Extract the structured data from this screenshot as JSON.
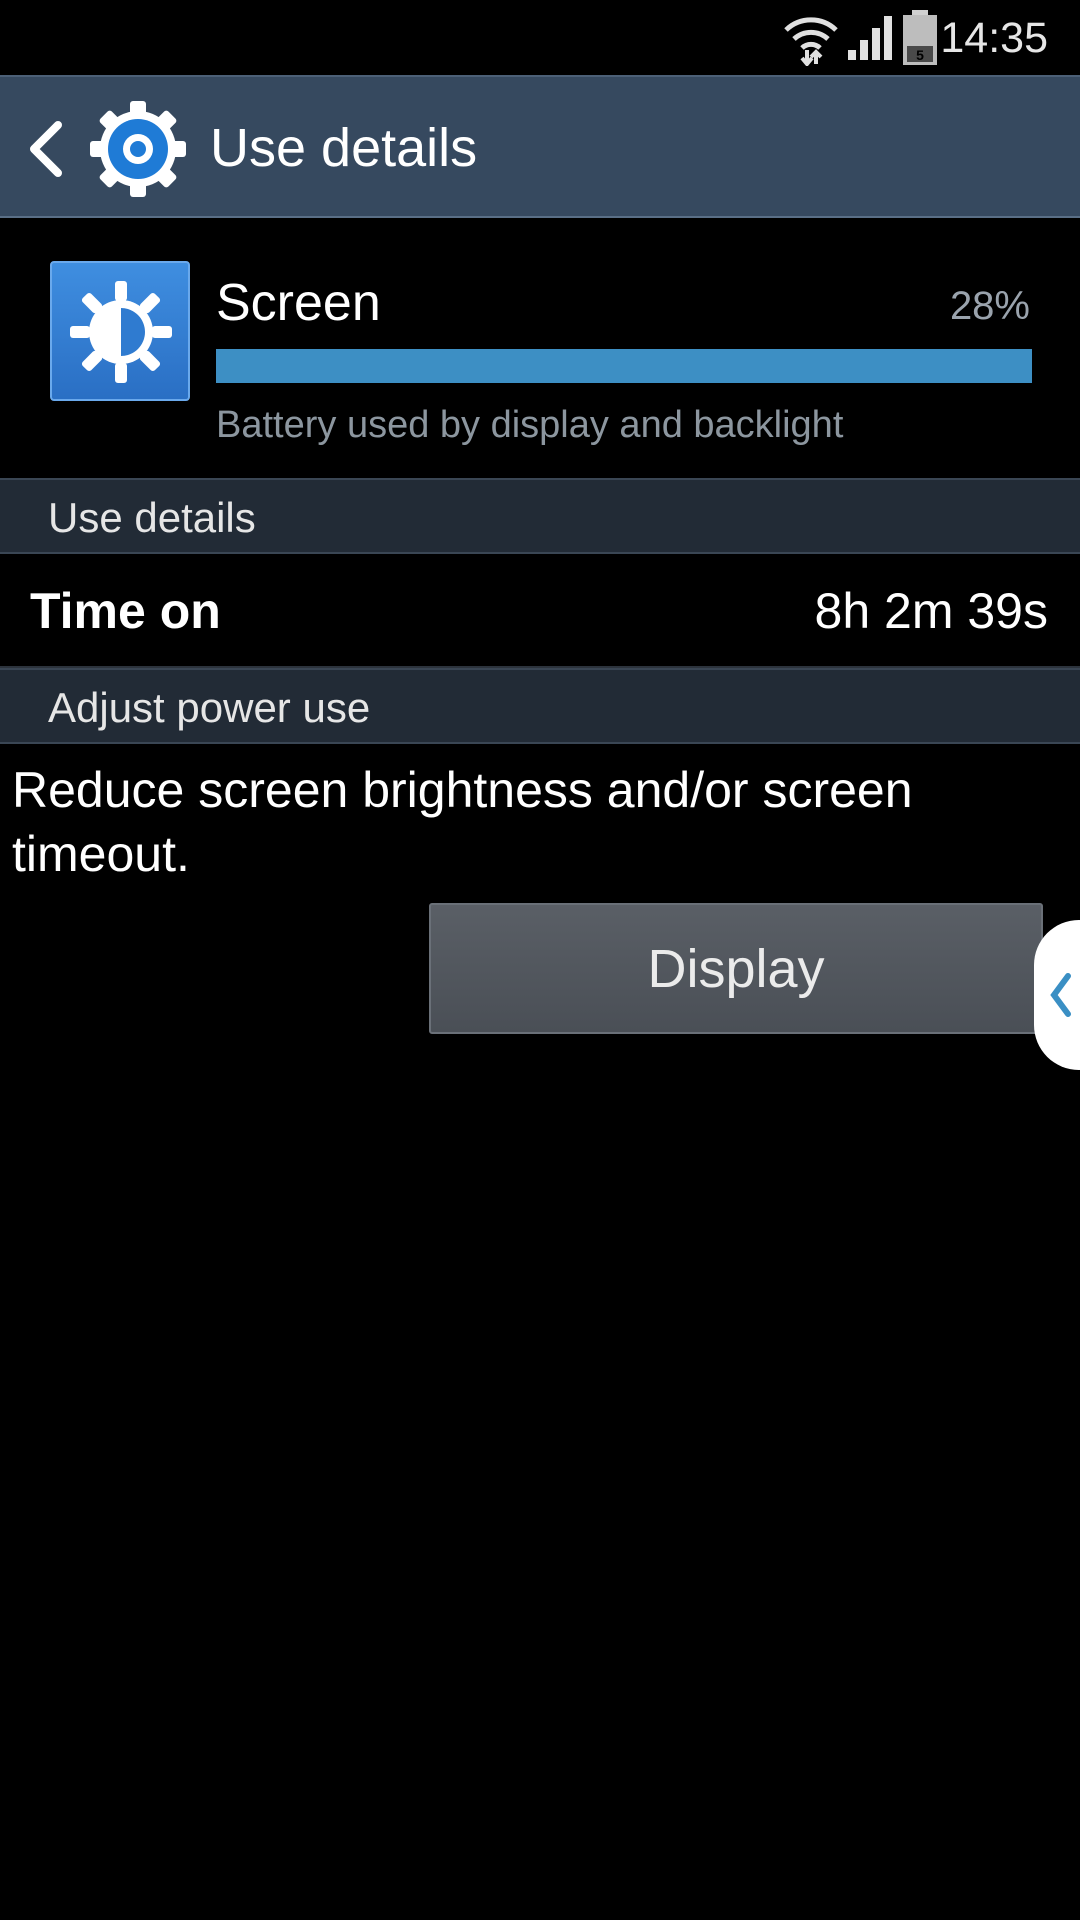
{
  "status_bar": {
    "time": "14:35",
    "battery_level": "5",
    "icons": [
      "wifi-icon",
      "signal-icon",
      "battery-icon"
    ]
  },
  "action_bar": {
    "title": "Use details",
    "icons": [
      "back-icon",
      "settings-icon"
    ]
  },
  "usage_item": {
    "name": "Screen",
    "percent": "28%",
    "bar_fraction": 1.0,
    "description": "Battery used by display and backlight",
    "icon": "brightness-icon"
  },
  "sections": {
    "use_details_header": "Use details",
    "adjust_power_header": "Adjust power use"
  },
  "details": {
    "time_on_label": "Time on",
    "time_on_value": "8h 2m 39s"
  },
  "advice": {
    "text": "Reduce screen brightness and/or screen timeout.",
    "button_label": "Display"
  },
  "colors": {
    "action_bar_bg": "#36495f",
    "section_header_bg": "#222b36",
    "accent_bar": "#3d8fc4",
    "app_icon_blue": "#3f8ee0"
  }
}
